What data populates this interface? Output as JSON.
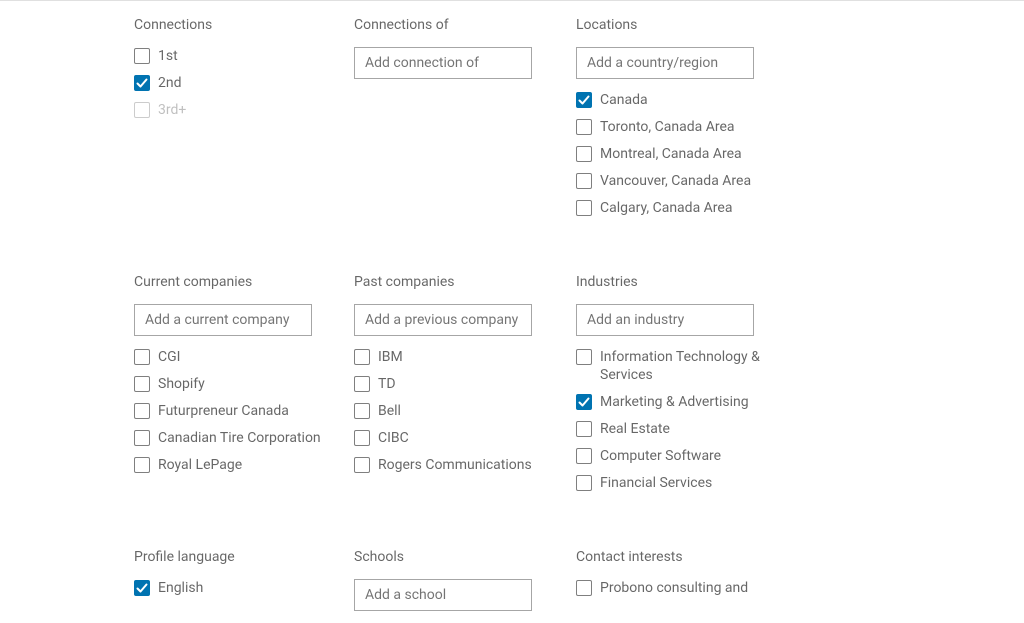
{
  "connections": {
    "heading": "Connections",
    "items": [
      {
        "label": "1st",
        "checked": false,
        "disabled": false
      },
      {
        "label": "2nd",
        "checked": true,
        "disabled": false
      },
      {
        "label": "3rd+",
        "checked": false,
        "disabled": true
      }
    ]
  },
  "connectionsOf": {
    "heading": "Connections of",
    "placeholder": "Add connection of"
  },
  "locations": {
    "heading": "Locations",
    "placeholder": "Add a country/region",
    "items": [
      {
        "label": "Canada",
        "checked": true
      },
      {
        "label": "Toronto, Canada Area",
        "checked": false
      },
      {
        "label": "Montreal, Canada Area",
        "checked": false
      },
      {
        "label": "Vancouver, Canada Area",
        "checked": false
      },
      {
        "label": "Calgary, Canada Area",
        "checked": false
      }
    ]
  },
  "currentCompanies": {
    "heading": "Current companies",
    "placeholder": "Add a current company",
    "items": [
      {
        "label": "CGI",
        "checked": false
      },
      {
        "label": "Shopify",
        "checked": false
      },
      {
        "label": "Futurpreneur Canada",
        "checked": false
      },
      {
        "label": "Canadian Tire Corporation",
        "checked": false
      },
      {
        "label": "Royal LePage",
        "checked": false
      }
    ]
  },
  "pastCompanies": {
    "heading": "Past companies",
    "placeholder": "Add a previous company",
    "items": [
      {
        "label": "IBM",
        "checked": false
      },
      {
        "label": "TD",
        "checked": false
      },
      {
        "label": "Bell",
        "checked": false
      },
      {
        "label": "CIBC",
        "checked": false
      },
      {
        "label": "Rogers Communications",
        "checked": false
      }
    ]
  },
  "industries": {
    "heading": "Industries",
    "placeholder": "Add an industry",
    "items": [
      {
        "label": "Information Technology & Services",
        "checked": false
      },
      {
        "label": "Marketing & Advertising",
        "checked": true
      },
      {
        "label": "Real Estate",
        "checked": false
      },
      {
        "label": "Computer Software",
        "checked": false
      },
      {
        "label": "Financial Services",
        "checked": false
      }
    ]
  },
  "profileLanguage": {
    "heading": "Profile language",
    "items": [
      {
        "label": "English",
        "checked": true
      }
    ]
  },
  "schools": {
    "heading": "Schools",
    "placeholder": "Add a school"
  },
  "contactInterests": {
    "heading": "Contact interests",
    "items": [
      {
        "label": "Probono consulting and",
        "checked": false
      }
    ]
  }
}
